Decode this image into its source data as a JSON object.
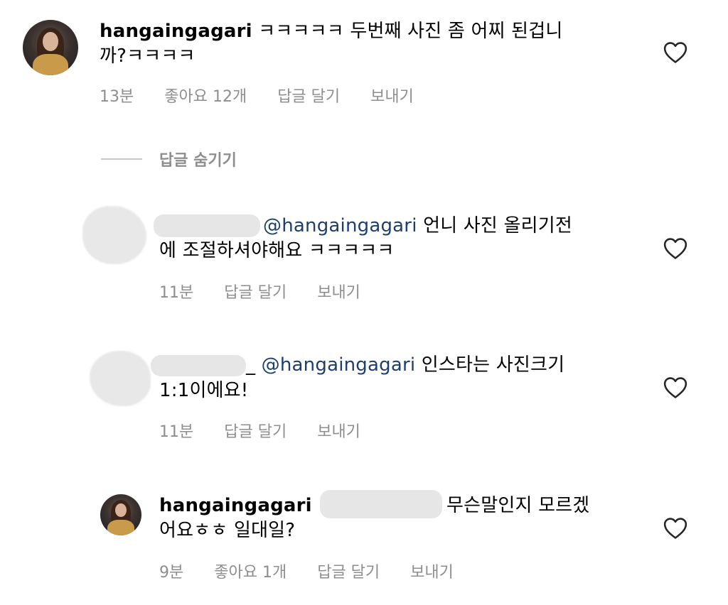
{
  "comments": [
    {
      "username": "hangaingagari",
      "line1": "ㅋㅋㅋㅋㅋ 두번째 사진 좀 어찌 된겁니",
      "line2": "까?ㅋㅋㅋㅋ",
      "time": "13분",
      "likes": "좋아요 12개",
      "reply": "답글 달기",
      "send": "보내기"
    },
    {
      "mention": "@hangaingagari",
      "line1": " 언니 사진 올리기전",
      "line2": "에 조절하셔야해요 ㅋㅋㅋㅋㅋ",
      "time": "11분",
      "reply": "답글 달기",
      "send": "보내기"
    },
    {
      "username_fragment": "_",
      "mention": "@hangaingagari",
      "line1": " 인스타는 사진크기",
      "line2": "1:1이에요!",
      "time": "11분",
      "reply": "답글 달기",
      "send": "보내기"
    },
    {
      "username": "hangaingagari",
      "line1": "무슨말인지 모르겠",
      "line2": "어요ㅎㅎ 일대일?",
      "time": "9분",
      "likes": "좋아요 1개",
      "reply": "답글 달기",
      "send": "보내기"
    }
  ],
  "hide_replies_label": "답글 숨기기",
  "icons": {
    "like": "heart-outline-icon"
  },
  "colors": {
    "meta": "#8e8e8e",
    "mention": "#1c3f6e",
    "text": "#000000"
  }
}
